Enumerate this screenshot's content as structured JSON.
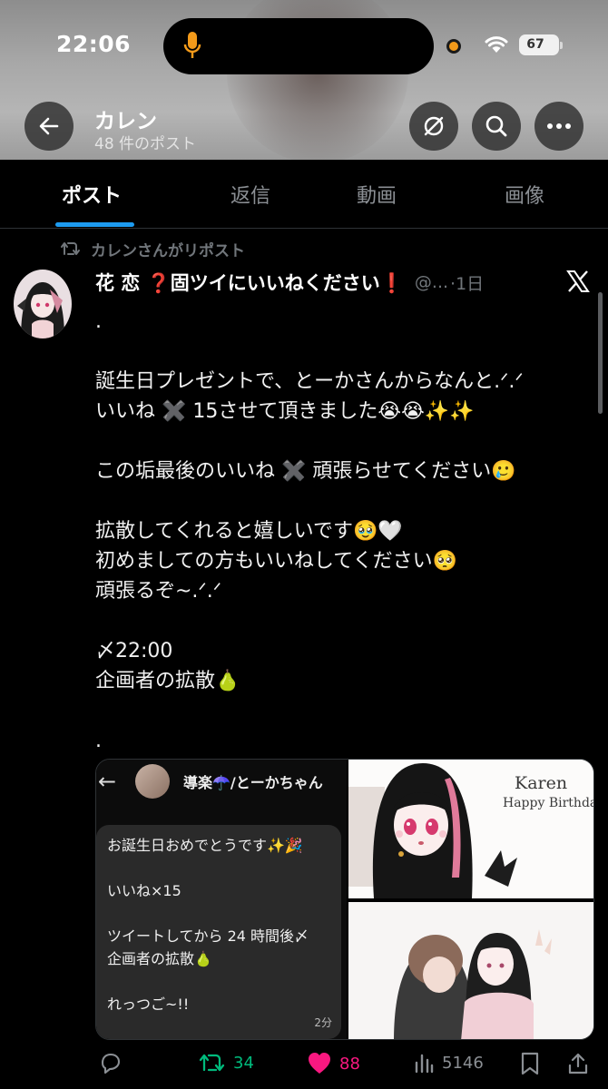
{
  "status_bar": {
    "time": "22:06",
    "battery": "67"
  },
  "header": {
    "title": "カレン",
    "post_count": "48 件のポスト"
  },
  "tabs": [
    {
      "label": "ポスト",
      "active": true
    },
    {
      "label": "返信"
    },
    {
      "label": "動画"
    },
    {
      "label": "画像"
    }
  ],
  "post": {
    "repost_label": "カレンさんがリポスト",
    "author_name": "花 恋 ❓固ツイにいいねください❗",
    "handle": "@...",
    "time": "·1日",
    "lines": [
      ".",
      "",
      "誕生日プレゼントで、とーかさんからなんと.ᐟ.ᐟ",
      "いいね ✖️ 15させて頂きました😭😭✨✨",
      "",
      "この垢最後のいいね ✖️ 頑張らせてください🥲",
      "",
      "拡散してくれると嬉しいです🥹🤍",
      "初めましての方もいいねしてください🥺",
      "頑張るぞ~.ᐟ.ᐟ",
      "",
      "〆22:00",
      "企画者の拡散🍐",
      "",
      "."
    ],
    "media": {
      "screenshot": {
        "back": "←",
        "name": "導楽☂️/とーかちゃん",
        "message_lines": [
          "お誕生日おめでとうです✨🎉",
          "",
          "いいね×15",
          "",
          "ツイートしてから 24 時間後〆",
          "企画者の拡散🍐",
          "",
          "れっつご~!!"
        ],
        "time": "2分"
      },
      "art_title": "Karen",
      "art_subtitle": "Happy Birthday"
    },
    "actions": {
      "reposts": "34",
      "likes": "88",
      "views": "5146"
    }
  },
  "colors": {
    "accent": "#1d9bf0",
    "repost_green": "#00ba7c",
    "like_pink": "#f91880"
  }
}
